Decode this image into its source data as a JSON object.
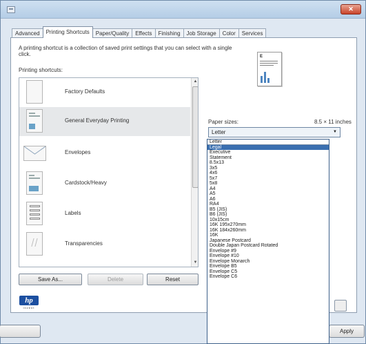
{
  "window": {
    "close_label": "✕"
  },
  "tabs": [
    {
      "label": "Advanced"
    },
    {
      "label": "Printing Shortcuts"
    },
    {
      "label": "Paper/Quality"
    },
    {
      "label": "Effects"
    },
    {
      "label": "Finishing"
    },
    {
      "label": "Job Storage"
    },
    {
      "label": "Color"
    },
    {
      "label": "Services"
    }
  ],
  "active_tab": "Printing Shortcuts",
  "description": "A printing shortcut is a collection of saved print settings that you can select with a single click.",
  "shortcuts_label": "Printing shortcuts:",
  "shortcuts": [
    {
      "label": "Factory Defaults",
      "icon": "blank-page-icon"
    },
    {
      "label": "General Everyday Printing",
      "icon": "document-icon"
    },
    {
      "label": "Envelopes",
      "icon": "envelope-icon"
    },
    {
      "label": "Cardstock/Heavy",
      "icon": "cardstock-icon"
    },
    {
      "label": "Labels",
      "icon": "labels-icon"
    },
    {
      "label": "Transparencies",
      "icon": "transparency-icon"
    }
  ],
  "selected_shortcut": "General Everyday Printing",
  "buttons": {
    "save_as": "Save As...",
    "delete": "Delete",
    "reset": "Reset",
    "apply": "Apply"
  },
  "hp_logo": {
    "mark": "hp",
    "tagline": "invent"
  },
  "paper": {
    "label": "Paper sizes:",
    "dimensions": "8.5 × 11 inches",
    "selected": "Letter"
  },
  "paper_options": [
    "Letter",
    "Legal",
    "Executive",
    "Statement",
    "8.5x13",
    "3x5",
    "4x6",
    "5x7",
    "5x8",
    "A4",
    "A5",
    "A6",
    "RA4",
    "B5 (JIS)",
    "B6 (JIS)",
    "10x15cm",
    "16K 195x270mm",
    "16K 184x260mm",
    "16K",
    "Japanese Postcard",
    "Double Japan Postcard Rotated",
    "Envelope #9",
    "Envelope #10",
    "Envelope Monarch",
    "Envelope B5",
    "Envelope C5",
    "Envelope C6"
  ],
  "highlighted_option": "Legal",
  "colors": {
    "accent": "#3a6fb0",
    "hp_blue": "#1c4fa0",
    "close_red": "#c9432a"
  }
}
